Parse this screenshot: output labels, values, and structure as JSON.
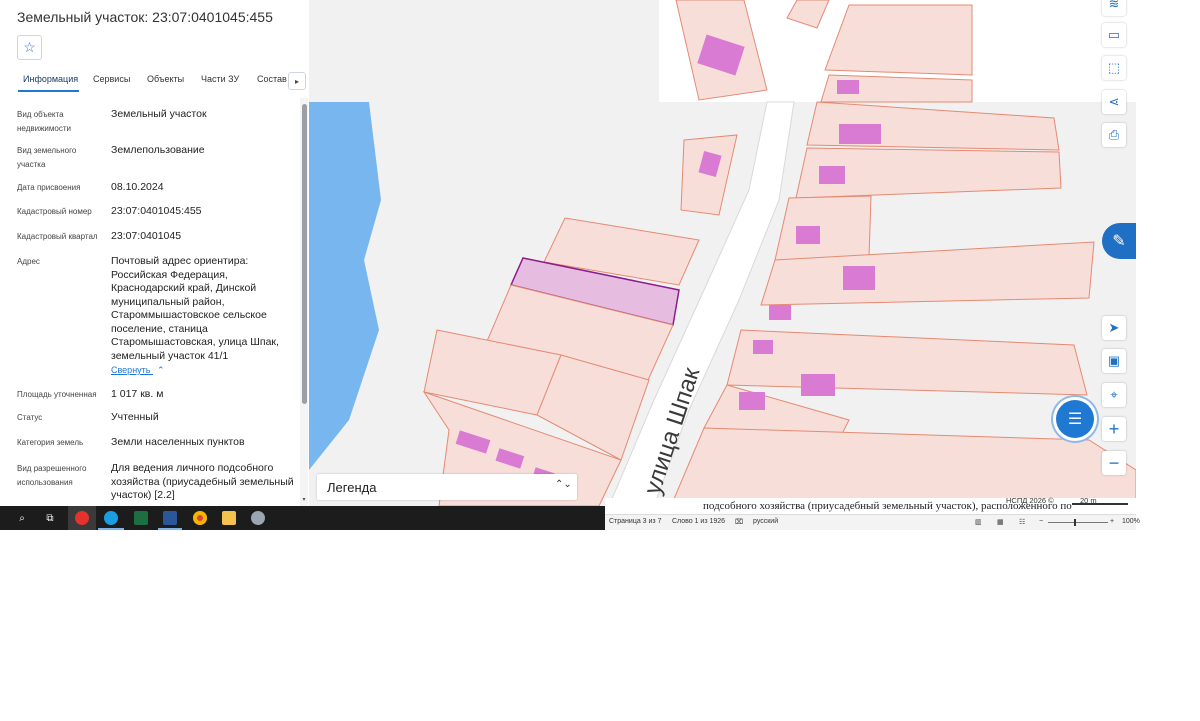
{
  "panel": {
    "title": "Земельный участок: 23:07:0401045:455",
    "favorite_icon": "star-icon",
    "tabs": [
      "Информация",
      "Сервисы",
      "Объекты",
      "Части ЗУ",
      "Состав"
    ],
    "tab_more_icon": "chevron-right-icon",
    "properties": [
      {
        "label": "Вид объекта недвижимости",
        "value": "Земельный участок"
      },
      {
        "label": "Вид земельного участка",
        "value": "Землепользование"
      },
      {
        "label": "Дата присвоения",
        "value": "08.10.2024"
      },
      {
        "label": "Кадастровый номер",
        "value": "23:07:0401045:455"
      },
      {
        "label": "Кадастровый квартал",
        "value": "23:07:0401045"
      },
      {
        "label": "Адрес",
        "value": "Почтовый адрес ориентира: Российская Федерация, Краснодарский край, Динской муниципальный район, Староммышастовское сельское поселение, станица Старомышастовская, улица Шпак, земельный участок 41/1"
      },
      {
        "label": "Площадь уточненная",
        "value": "1 017 кв. м"
      },
      {
        "label": "Статус",
        "value": "Учтенный"
      },
      {
        "label": "Категория земель",
        "value": "Земли населенных пунктов"
      },
      {
        "label": "Вид разрешенного использования",
        "value": "Для ведения личного подсобного хозяйства (приусадебный земельный участок) [2.2]"
      }
    ],
    "collapse_link": "Свернуть"
  },
  "map": {
    "street_label": "улица Шпак",
    "legend_label": "Легенда",
    "attribution": "НСПД 2026 ©",
    "scale_label": "20 m",
    "controls": [
      "layers-icon",
      "ruler-icon",
      "select-area-icon",
      "share-icon",
      "print-icon",
      "locate-icon",
      "minimap-icon",
      "location-pin-icon",
      "zoom-in-icon",
      "zoom-out-icon"
    ],
    "colors": {
      "parcel_fill": "#f7ded9",
      "parcel_stroke": "#e58a72",
      "building": "#d97ad3",
      "selected_fill": "#e6bde0",
      "selected_stroke": "#8a1d8a",
      "water": "#78b6ef",
      "road": "#ffffff"
    }
  },
  "word": {
    "text_line": "подсобного хозяйства (приусадебный земельный участок), расположенного по",
    "page": "Страница 3 из 7",
    "words": "Слово 1 из 1926",
    "language": "русский",
    "zoom": "100%"
  },
  "taskbar": {
    "icons": [
      "search-icon",
      "task-view-icon",
      "yandex-browser-icon",
      "edge-icon",
      "excel-icon",
      "word-icon",
      "chrome-icon",
      "explorer-icon",
      "app-icon"
    ]
  }
}
